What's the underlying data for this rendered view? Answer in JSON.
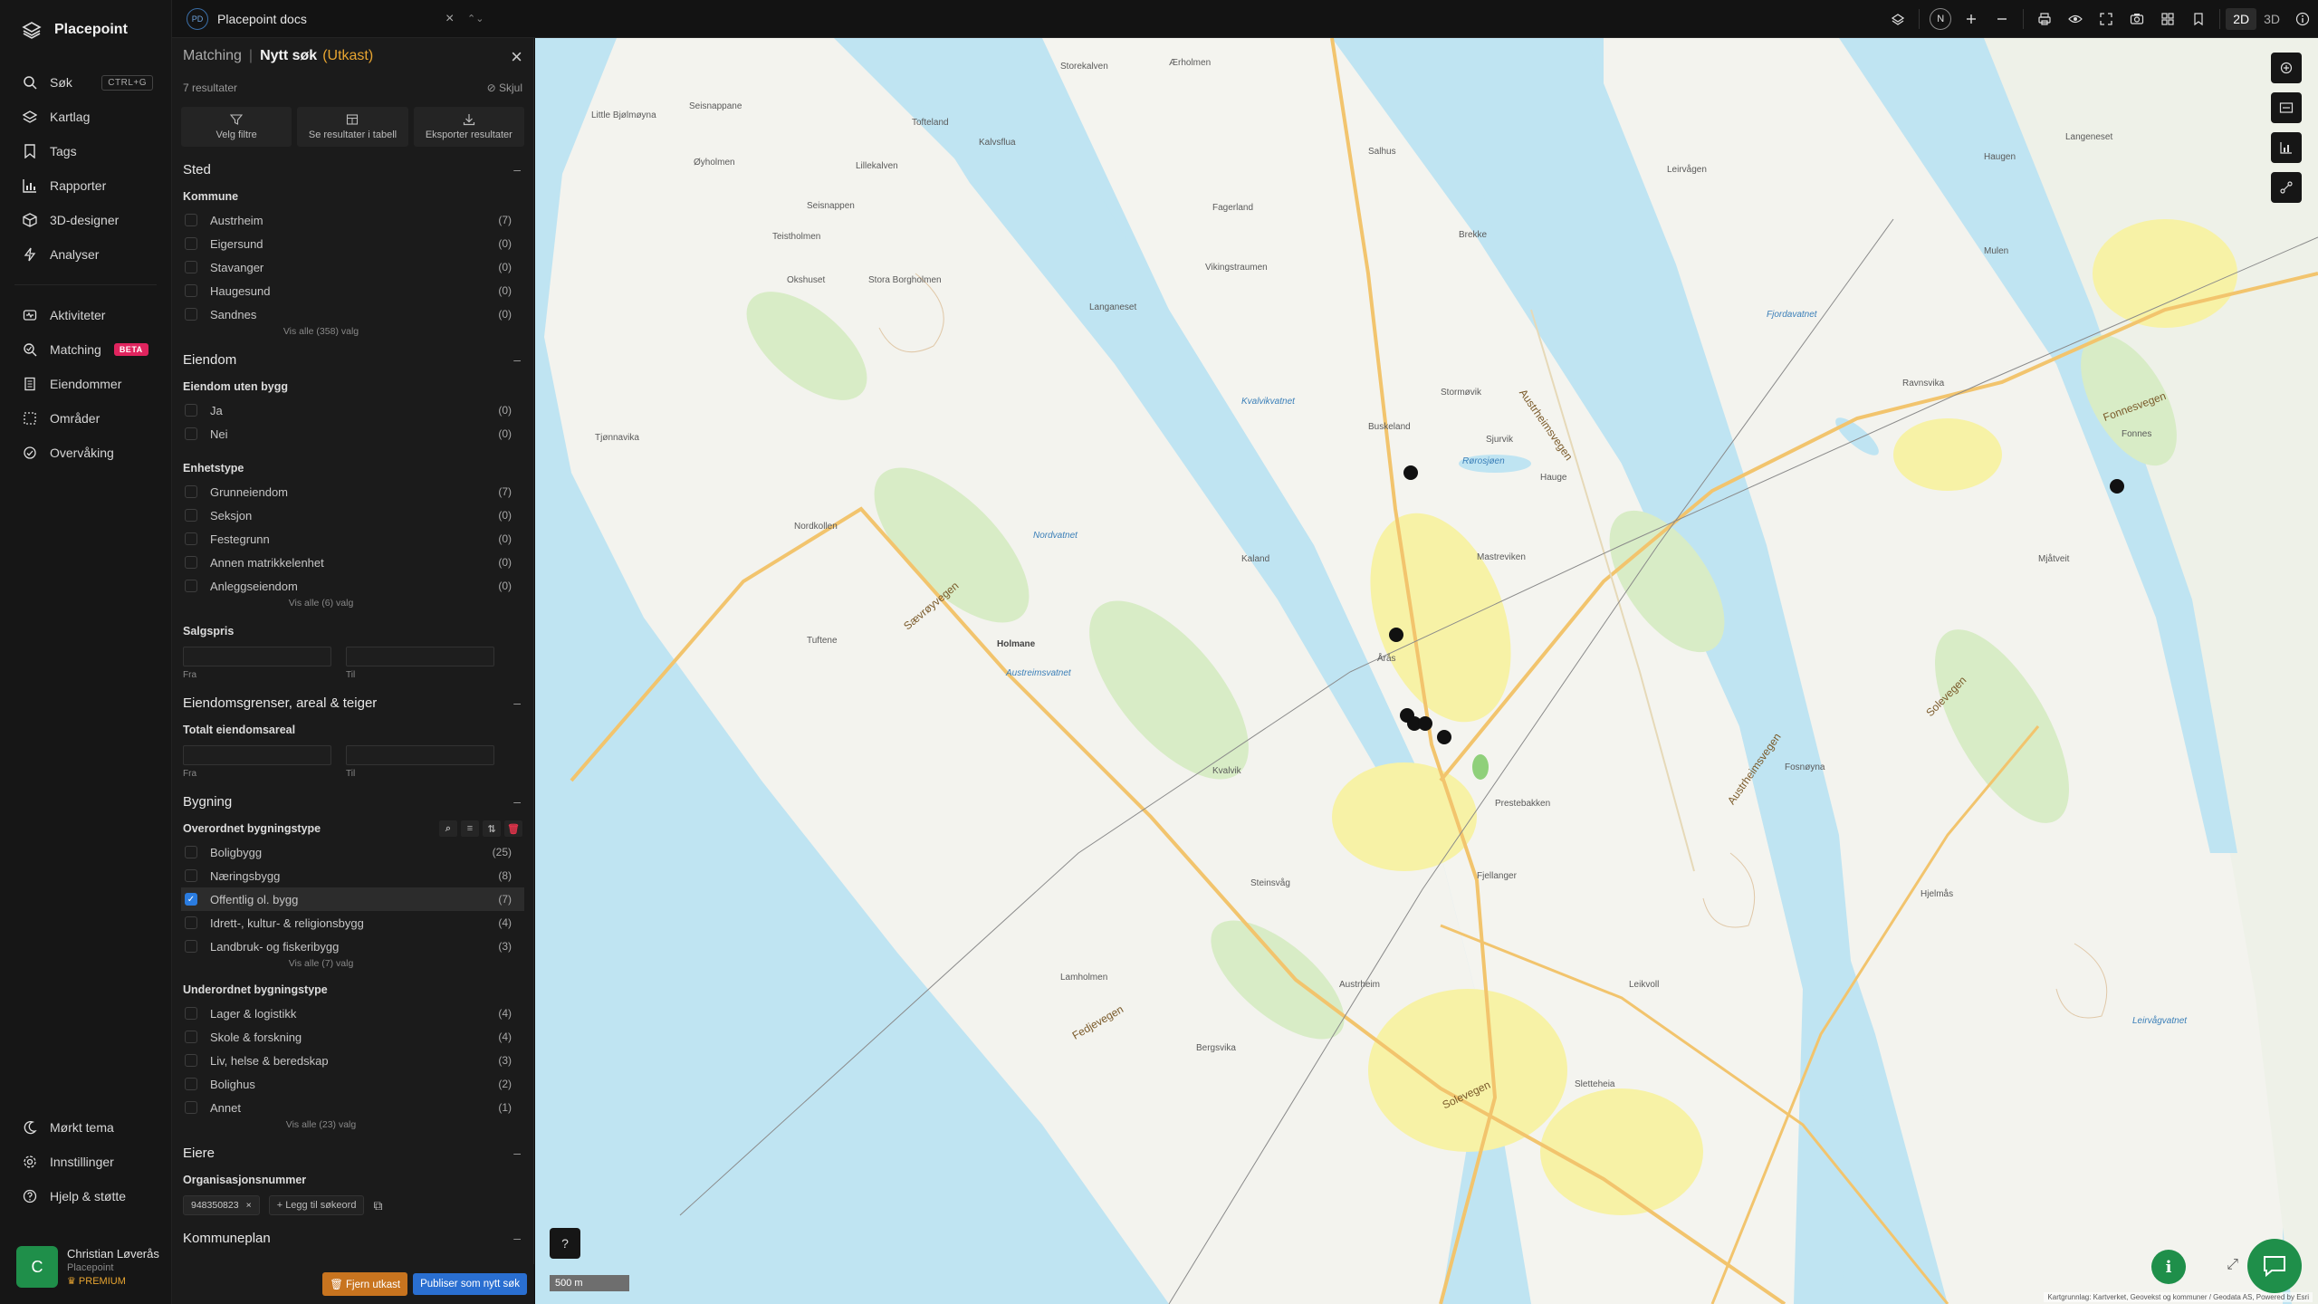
{
  "app": {
    "brand": "Placepoint",
    "nav": {
      "primary": [
        {
          "label": "Søk",
          "icon": "search-icon",
          "shortcut": "CTRL+G"
        },
        {
          "label": "Kartlag",
          "icon": "layers-icon"
        },
        {
          "label": "Tags",
          "icon": "bookmark-icon"
        },
        {
          "label": "Rapporter",
          "icon": "chart-icon"
        },
        {
          "label": "3D-designer",
          "icon": "cube-icon"
        },
        {
          "label": "Analyser",
          "icon": "bolt-icon"
        }
      ],
      "secondary": [
        {
          "label": "Aktiviteter",
          "icon": "activity-icon"
        },
        {
          "label": "Matching",
          "icon": "matching-icon",
          "badge": "BETA"
        },
        {
          "label": "Eiendommer",
          "icon": "building-icon"
        },
        {
          "label": "Områder",
          "icon": "area-icon"
        },
        {
          "label": "Overvåking",
          "icon": "monitor-icon"
        }
      ],
      "bottom": [
        {
          "label": "Mørkt tema",
          "icon": "moon-icon"
        },
        {
          "label": "Innstillinger",
          "icon": "gear-icon"
        },
        {
          "label": "Hjelp & støtte",
          "icon": "help-icon"
        }
      ]
    },
    "user": {
      "initial": "C",
      "name": "Christian Løverås",
      "org": "Placepoint",
      "tier": "PREMIUM"
    }
  },
  "topbar": {
    "doc_chip": "PD",
    "doc_title": "Placepoint docs",
    "north": "N",
    "modes": [
      "2D",
      "3D"
    ],
    "active_mode": "2D"
  },
  "panel": {
    "crumb": "Matching",
    "title": "Nytt søk",
    "draft": "(Utkast)",
    "result_count": "7 resultater",
    "hide": "Skjul",
    "actions": [
      "Velg filtre",
      "Se resultater i tabell",
      "Eksporter resultater"
    ],
    "sections": {
      "sted": {
        "title": "Sted",
        "kommune": {
          "title": "Kommune",
          "items": [
            {
              "label": "Austrheim",
              "count": "(7)"
            },
            {
              "label": "Eigersund",
              "count": "(0)"
            },
            {
              "label": "Stavanger",
              "count": "(0)"
            },
            {
              "label": "Haugesund",
              "count": "(0)"
            },
            {
              "label": "Sandnes",
              "count": "(0)"
            }
          ],
          "show_all": "Vis alle (358) valg"
        }
      },
      "eiendom": {
        "title": "Eiendom",
        "uten_bygg": {
          "title": "Eiendom uten bygg",
          "items": [
            {
              "label": "Ja",
              "count": "(0)"
            },
            {
              "label": "Nei",
              "count": "(0)"
            }
          ]
        },
        "enhetstype": {
          "title": "Enhetstype",
          "items": [
            {
              "label": "Grunneiendom",
              "count": "(7)"
            },
            {
              "label": "Seksjon",
              "count": "(0)"
            },
            {
              "label": "Festegrunn",
              "count": "(0)"
            },
            {
              "label": "Annen matrikkelenhet",
              "count": "(0)"
            },
            {
              "label": "Anleggseiendom",
              "count": "(0)"
            }
          ],
          "show_all": "Vis alle (6) valg"
        },
        "salgspris": {
          "title": "Salgspris",
          "from": "Fra",
          "to": "Til"
        }
      },
      "grenser": {
        "title": "Eiendomsgrenser, areal & teiger",
        "total": {
          "title": "Totalt eiendomsareal",
          "from": "Fra",
          "to": "Til"
        }
      },
      "bygning": {
        "title": "Bygning",
        "overordnet": {
          "title": "Overordnet bygningstype",
          "items": [
            {
              "label": "Boligbygg",
              "count": "(25)",
              "checked": false
            },
            {
              "label": "Næringsbygg",
              "count": "(8)",
              "checked": false
            },
            {
              "label": "Offentlig ol. bygg",
              "count": "(7)",
              "checked": true
            },
            {
              "label": "Idrett-, kultur- & religionsbygg",
              "count": "(4)",
              "checked": false
            },
            {
              "label": "Landbruk- og fiskeribygg",
              "count": "(3)",
              "checked": false
            }
          ],
          "show_all": "Vis alle (7) valg"
        },
        "underordnet": {
          "title": "Underordnet bygningstype",
          "items": [
            {
              "label": "Lager & logistikk",
              "count": "(4)"
            },
            {
              "label": "Skole & forskning",
              "count": "(4)"
            },
            {
              "label": "Liv, helse & beredskap",
              "count": "(3)"
            },
            {
              "label": "Bolighus",
              "count": "(2)"
            },
            {
              "label": "Annet",
              "count": "(1)"
            }
          ],
          "show_all": "Vis alle (23) valg"
        }
      },
      "eiere": {
        "title": "Eiere",
        "org": {
          "title": "Organisasjonsnummer",
          "chip": "948350823",
          "add": "Legg til søkeord"
        }
      },
      "kommuneplan": {
        "title": "Kommuneplan"
      }
    },
    "footer": {
      "discard": "Fjern utkast",
      "publish": "Publiser som nytt søk"
    }
  },
  "map": {
    "scale": "500 m",
    "attribution": "Kartgrunnlag: Kartverket, Geovekst og kommuner / Geodata AS, Powered by Esri",
    "labels": {
      "places": [
        "Storekalven",
        "Ærholmen",
        "Seisnappane",
        "Tofteland",
        "Kalvsflua",
        "Little Bjølmøyna",
        "Lillekalven",
        "Øyholmen",
        "Seisnappen",
        "Teistholmen",
        "Okshuset",
        "Stora Borgholmen",
        "Langaneset",
        "Fagerland",
        "Vikingstraumen",
        "Salhus",
        "Brekke",
        "Stormøvik",
        "Sjurvik",
        "Buskeland",
        "Mastreviken",
        "Nordkollen",
        "Kvalvik",
        "Årås",
        "Hauge",
        "Austrheim",
        "Hjelmås",
        "Lamholmen",
        "Bergsvika",
        "Tuftene",
        "Ravnsvika",
        "Fonnes",
        "Kaland",
        "Steinsvåg",
        "Sletteheia",
        "Prestebakken",
        "Haugen",
        "Langeneset",
        "Mulen",
        "Leirvågen",
        "Holmane",
        "Fosnøyna",
        "Mjåtveit",
        "Tjønnavika",
        "Fjellanger",
        "Leikvoll"
      ],
      "water": [
        "Kvalvikvatnet",
        "Austreimsvatnet",
        "Rørosjøen",
        "Nordvatnet",
        "Fjordavatnet",
        "Leirvågvatnet"
      ],
      "roads": [
        "Austrheimsvegen",
        "Sævrøyvegen",
        "Fonnesvegen",
        "Fedjevegen",
        "Solevegen",
        "Austrheimsvegen",
        "Solevegen"
      ]
    }
  }
}
